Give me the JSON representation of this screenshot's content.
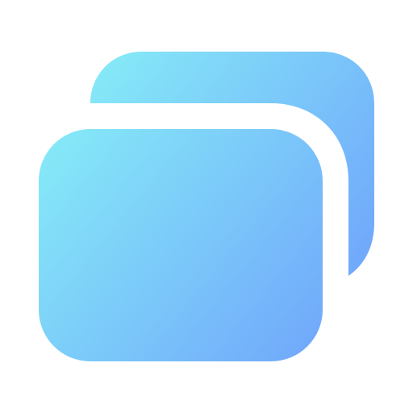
{
  "icon": {
    "name": "stacked-cards-icon",
    "back_card": "back-card-shape",
    "front_card": "front-card-shape"
  },
  "colors": {
    "background": "#ffffff",
    "gradient_start": "#86ecf7",
    "gradient_end": "#70a6fb",
    "separator": "#ffffff"
  }
}
